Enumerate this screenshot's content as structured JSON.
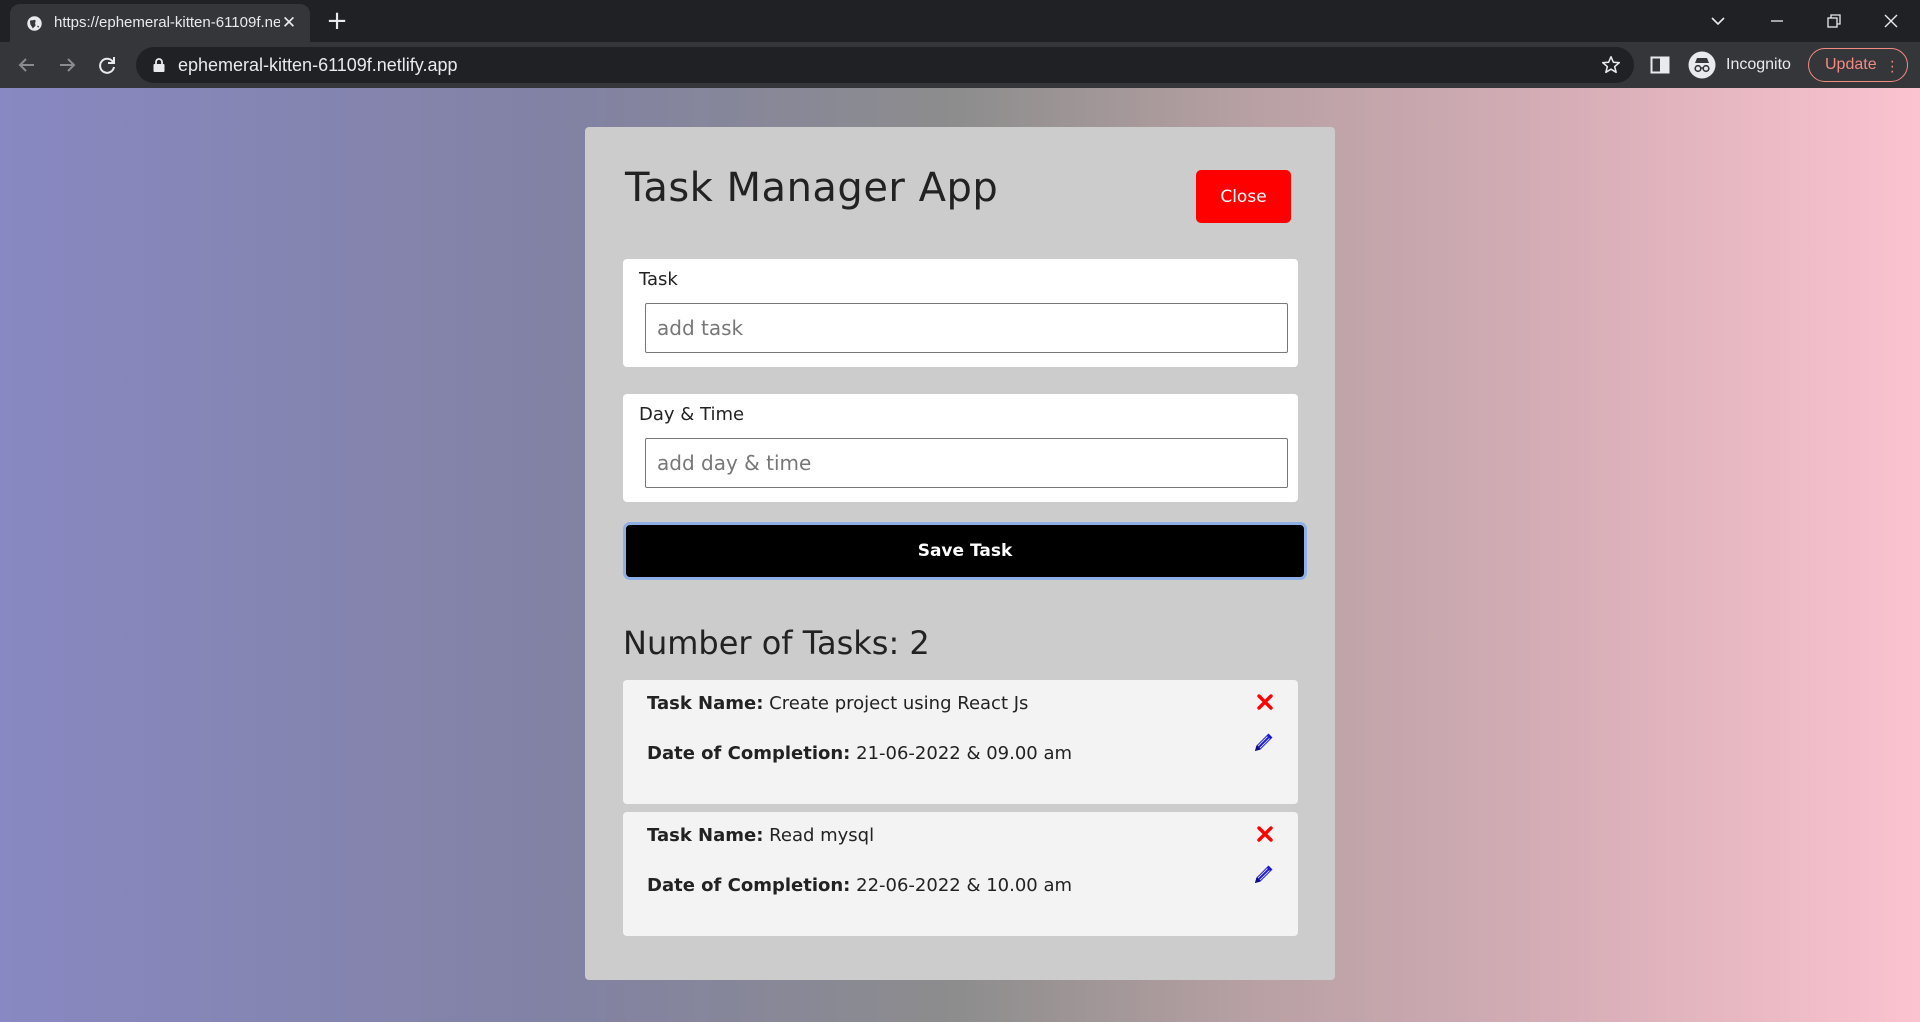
{
  "browser": {
    "tab_title": "https://ephemeral-kitten-61109f.netlify.app",
    "url": "ephemeral-kitten-61109f.netlify.app",
    "profile_label": "Incognito",
    "update_label": "Update"
  },
  "app": {
    "title": "Task Manager App",
    "close_label": "Close",
    "task_field": {
      "label": "Task",
      "placeholder": "add task",
      "value": ""
    },
    "datetime_field": {
      "label": "Day & Time",
      "placeholder": "add day & time",
      "value": ""
    },
    "save_label": "Save Task",
    "count_text": "Number of Tasks: 2",
    "task_name_label": "Task Name:",
    "date_label": "Date of Completion:",
    "tasks": [
      {
        "name": "Create project using React Js",
        "date": "21-06-2022 & 09.00 am"
      },
      {
        "name": "Read mysql",
        "date": "22-06-2022 & 10.00 am"
      }
    ]
  },
  "colors": {
    "close_button": "#ff0000",
    "save_button": "#000000",
    "delete_icon": "#ff0000",
    "edit_icon": "#1a1acc"
  },
  "icons": [
    "globe-icon",
    "close-icon",
    "plus-icon",
    "chevron-down-icon",
    "minimize-icon",
    "restore-icon",
    "back-icon",
    "forward-icon",
    "reload-icon",
    "lock-icon",
    "star-icon",
    "side-panel-icon",
    "incognito-icon",
    "kebab-menu-icon",
    "delete-icon",
    "edit-icon"
  ]
}
